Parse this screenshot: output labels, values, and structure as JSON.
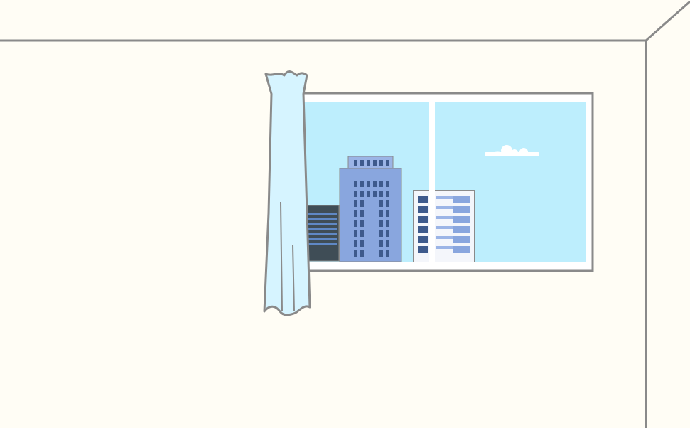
{
  "scene": {
    "description_tags": [
      "room-wall",
      "window",
      "city-buildings",
      "cloud",
      "curtain"
    ],
    "colors": {
      "wall": "#fffdf5",
      "outline": "#8a8a8a",
      "sky": "#bdeefd",
      "window_frame": "#ffffff",
      "curtain_fill": "#d6f4ff",
      "building_blue": "#89a6de",
      "building_blue_light": "#9bb4e6",
      "building_dark": "#3f4d56",
      "building_white": "#f4f6fb",
      "window_dark": "#3e5a8c",
      "window_mid": "#5f88c5",
      "cloud": "#ffffff"
    }
  }
}
